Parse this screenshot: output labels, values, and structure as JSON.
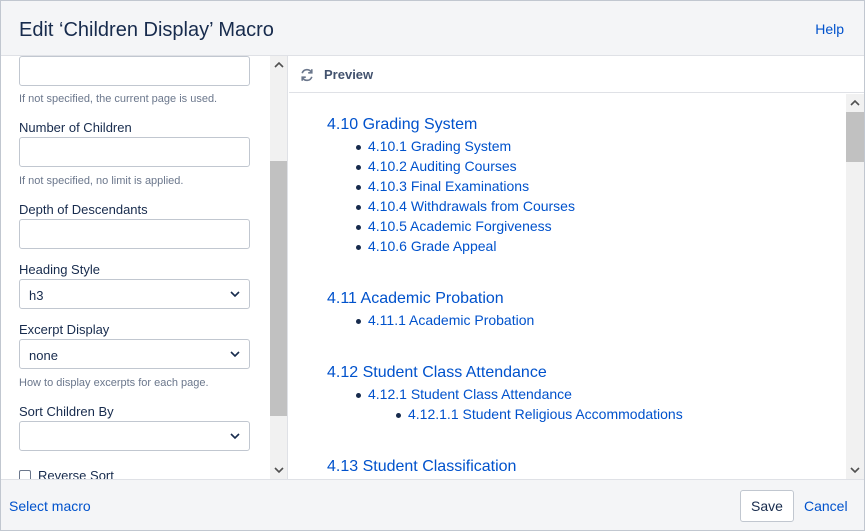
{
  "dialog": {
    "title": "Edit ‘Children Display’ Macro",
    "help_label": "Help"
  },
  "form": {
    "page_help": "If not specified, the current page is used.",
    "number_of_children": {
      "label": "Number of Children",
      "value": "",
      "help": "If not specified, no limit is applied."
    },
    "depth_of_descendants": {
      "label": "Depth of Descendants",
      "value": ""
    },
    "heading_style": {
      "label": "Heading Style",
      "value": "h3"
    },
    "excerpt_display": {
      "label": "Excerpt Display",
      "value": "none",
      "help": "How to display excerpts for each page."
    },
    "sort_children_by": {
      "label": "Sort Children By",
      "value": ""
    },
    "reverse_sort": {
      "label": "Reverse Sort",
      "checked": false
    }
  },
  "preview": {
    "title": "Preview",
    "sections": [
      {
        "heading": "4.10 Grading System",
        "items": [
          {
            "label": "4.10.1 Grading System"
          },
          {
            "label": "4.10.2 Auditing Courses"
          },
          {
            "label": "4.10.3 Final Examinations"
          },
          {
            "label": "4.10.4 Withdrawals from Courses"
          },
          {
            "label": "4.10.5 Academic Forgiveness"
          },
          {
            "label": "4.10.6 Grade Appeal"
          }
        ]
      },
      {
        "heading": "4.11 Academic Probation",
        "items": [
          {
            "label": "4.11.1 Academic Probation"
          }
        ]
      },
      {
        "heading": "4.12 Student Class Attendance",
        "items": [
          {
            "label": "4.12.1 Student Class Attendance"
          },
          {
            "label": "4.12.1.1 Student Religious Accommodations"
          }
        ]
      },
      {
        "heading": "4.13 Student Classification",
        "items": []
      }
    ]
  },
  "footer": {
    "select_macro_label": "Select macro",
    "save_label": "Save",
    "cancel_label": "Cancel"
  },
  "colors": {
    "link": "#0052cc",
    "text": "#172b4d",
    "muted": "#6b778c",
    "header_bg": "#f4f5f7"
  }
}
